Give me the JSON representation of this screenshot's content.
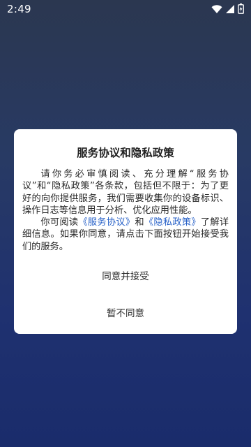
{
  "status_bar": {
    "time": "2:49",
    "icons": [
      "wifi-icon",
      "cellular-signal-icon",
      "battery-icon"
    ]
  },
  "dialog": {
    "title": "服务协议和隐私政策",
    "paragraph1": "请你务必审慎阅读、充分理解“服务协议”和“隐私政策”各条款，包括但不限于：为了更好的向你提供服务，我们需要收集你的设备标识、操作日志等信息用于分析、优化应用性能。",
    "paragraph2_prefix": "你可阅读",
    "link_service": "《服务协议》",
    "paragraph2_and": "和",
    "link_privacy": "《隐私政策》",
    "paragraph2_suffix": "了解详细信息。如果你同意，请点击下面按钮开始接受我们的服务。",
    "agree_button": "同意并接受",
    "disagree_button": "暂不同意"
  },
  "colors": {
    "background_top": "#2b3750",
    "background_bottom": "#1a2c6b",
    "link": "#2962c8",
    "dialog_bg": "#ffffff"
  }
}
